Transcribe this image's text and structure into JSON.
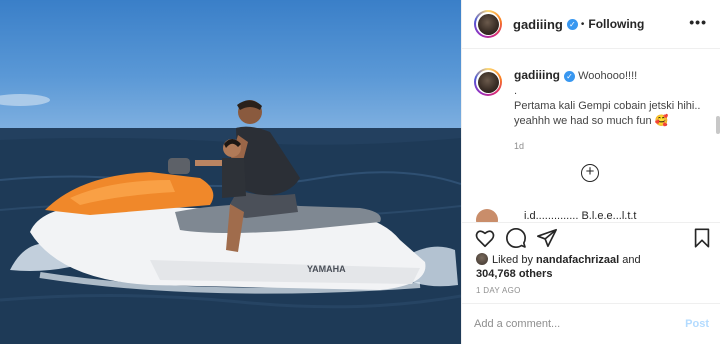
{
  "post": {
    "photo_alt": "Man and child riding a Yamaha jet ski on the sea",
    "jetski_brand": "YAMAHA"
  },
  "header": {
    "username": "gadiiing",
    "separator": "•",
    "follow_status": "Following",
    "more_label": "•••"
  },
  "caption": {
    "username": "gadiiing",
    "line1": "Woohooo!!!!",
    "line2": ".",
    "line3": "Pertama kali Gempi cobain jetski hihi..",
    "line4": "yeahhh we had so much fun 🥰",
    "time": "1d"
  },
  "cut_comment": {
    "text": "i.d.............. B.l.e.e...l.t.t"
  },
  "likes": {
    "prefix": "Liked by",
    "user": "nandafachrizaal",
    "and": "and",
    "count": "304,768 others"
  },
  "timestamp": "1 DAY AGO",
  "comment_input": {
    "placeholder": "Add a comment...",
    "post_label": "Post"
  },
  "icons": {
    "verified": "verified-badge-icon",
    "like": "heart-icon",
    "comment": "comment-bubble-icon",
    "share": "paper-plane-icon",
    "save": "bookmark-icon",
    "load_more": "plus-circle-icon"
  },
  "colors": {
    "link_blue": "#3897f0",
    "post_disabled": "#b3dbff",
    "muted": "#8e8e8e"
  }
}
